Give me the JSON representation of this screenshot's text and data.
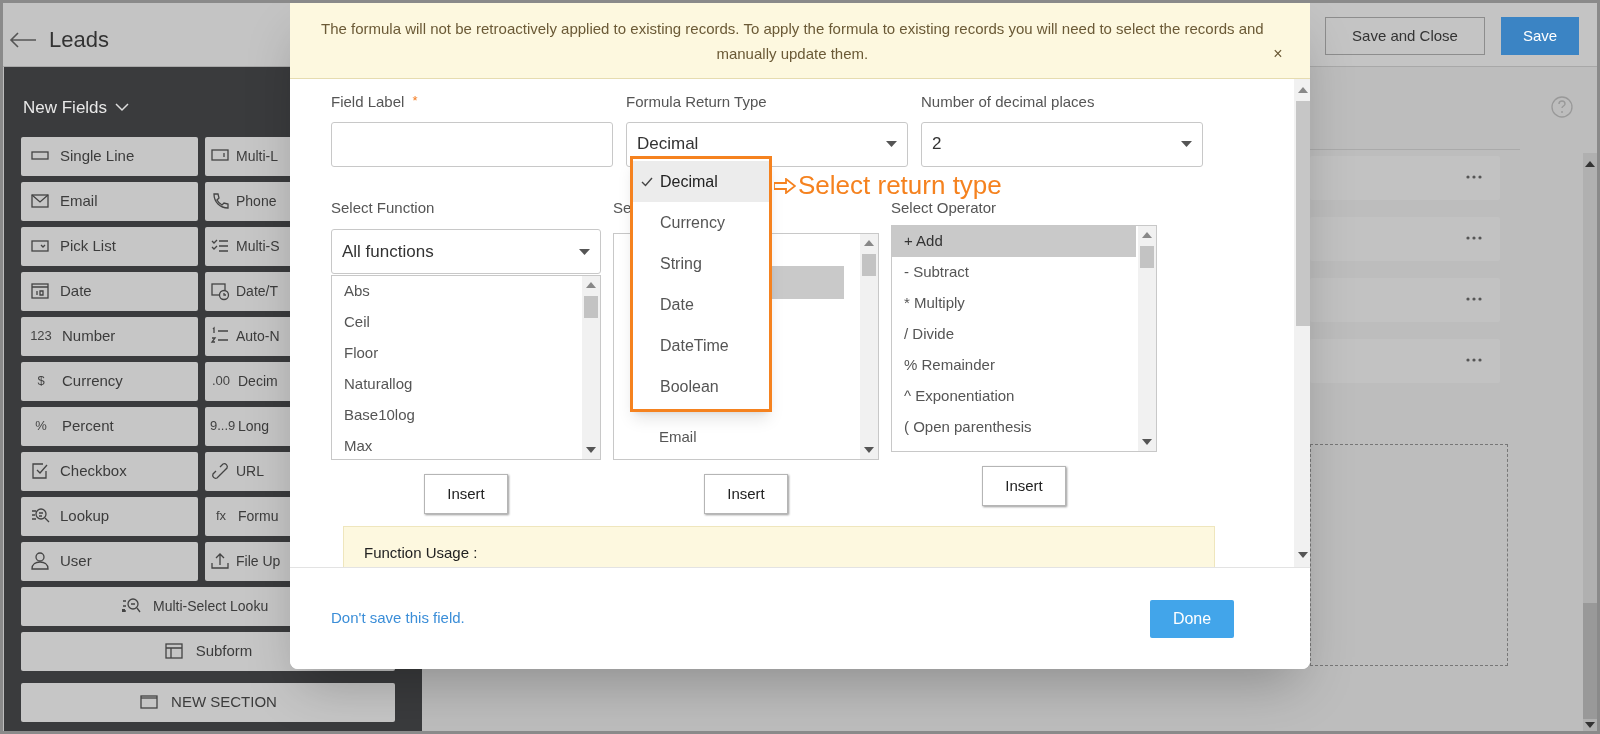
{
  "header": {
    "back_title": "Leads",
    "buttons": [
      {
        "label": "Save and Close",
        "kind": "secondary"
      },
      {
        "label": "Save",
        "kind": "primary"
      }
    ]
  },
  "sidebar": {
    "title": "New Fields",
    "fields": [
      {
        "label": "Single Line"
      },
      {
        "label": "Multi-L"
      },
      {
        "label": "Email"
      },
      {
        "label": "Phone"
      },
      {
        "label": "Pick List"
      },
      {
        "label": "Multi-S"
      },
      {
        "label": "Date"
      },
      {
        "label": "Date/T"
      },
      {
        "label": "Number",
        "glyph": "123"
      },
      {
        "label": "Auto-N"
      },
      {
        "label": "Currency",
        "glyph": "$"
      },
      {
        "label": "Decim",
        "glyph": ".00"
      },
      {
        "label": "Percent",
        "glyph": "%"
      },
      {
        "label": "Long",
        "glyph": "9...9"
      },
      {
        "label": "Checkbox"
      },
      {
        "label": "URL"
      },
      {
        "label": "Lookup"
      },
      {
        "label": "Formu",
        "glyph": "fx"
      },
      {
        "label": "User"
      },
      {
        "label": "File Up"
      }
    ],
    "wide_fields": [
      {
        "label": "Multi-Select Looku"
      },
      {
        "label": "Subform"
      },
      {
        "label": "NEW SECTION"
      }
    ]
  },
  "dialog": {
    "notice": "The formula will not be retroactively applied to existing records. To apply the formula to existing records you will need to select the records and manually update them.",
    "close": "×",
    "field_label": {
      "label": "Field Label",
      "required": "*"
    },
    "return_type": {
      "label": "Formula Return Type",
      "value": "Decimal",
      "options": [
        {
          "label": "Decimal",
          "selected": true
        },
        {
          "label": "Currency",
          "selected": false
        },
        {
          "label": "String",
          "selected": false
        },
        {
          "label": "Date",
          "selected": false
        },
        {
          "label": "DateTime",
          "selected": false
        },
        {
          "label": "Boolean",
          "selected": false
        }
      ]
    },
    "decimal_places": {
      "label": "Number of decimal places",
      "value": "2"
    },
    "annotation": "Select return type",
    "function_select": {
      "label": "Select Function",
      "value": "All functions",
      "items": [
        {
          "label": "Abs",
          "selected": false
        },
        {
          "label": "Ceil",
          "selected": false
        },
        {
          "label": "Floor",
          "selected": false
        },
        {
          "label": "Naturallog",
          "selected": false
        },
        {
          "label": "Base10log",
          "selected": false
        },
        {
          "label": "Max",
          "selected": false
        }
      ],
      "insert": "Insert"
    },
    "field_select": {
      "label": "Se",
      "items": [
        {
          "label": "Email",
          "selected": false
        }
      ],
      "insert": "Insert"
    },
    "operator_select": {
      "label": "Select Operator",
      "items": [
        {
          "label": "+ Add",
          "selected": true
        },
        {
          "label": "- Subtract",
          "selected": false
        },
        {
          "label": "* Multiply",
          "selected": false
        },
        {
          "label": "/ Divide",
          "selected": false
        },
        {
          "label": "% Remainder",
          "selected": false
        },
        {
          "label": "^ Exponentiation",
          "selected": false
        },
        {
          "label": "( Open parenthesis",
          "selected": false
        }
      ],
      "insert": "Insert"
    },
    "usage_title": "Function Usage :",
    "footer": {
      "link": "Don't save this field.",
      "done": "Done"
    }
  }
}
